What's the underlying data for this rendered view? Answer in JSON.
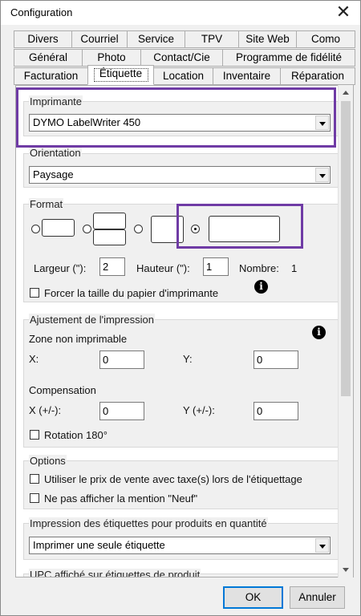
{
  "window": {
    "title": "Configuration"
  },
  "tabs": {
    "row1": [
      "Divers",
      "Courriel",
      "Service",
      "TPV",
      "Site Web",
      "Como"
    ],
    "row2": [
      "Général",
      "Photo",
      "Contact/Cie",
      "Programme de fidélité"
    ],
    "row3": [
      "Facturation",
      "Étiquette",
      "Location",
      "Inventaire",
      "Réparation"
    ],
    "active": "Étiquette"
  },
  "imprimante": {
    "label": "Imprimante",
    "selected": "DYMO LabelWriter 450"
  },
  "orientation": {
    "label": "Orientation",
    "selected": "Paysage"
  },
  "format": {
    "label": "Format",
    "selected_index": 3,
    "largeur_label": "Largeur (\"):",
    "largeur_value": "2",
    "hauteur_label": "Hauteur (\"):",
    "hauteur_value": "1",
    "nombre_label": "Nombre:",
    "nombre_value": "1",
    "force_paper_label": "Forcer la taille du papier d'imprimante"
  },
  "ajustement": {
    "label": "Ajustement de l'impression",
    "zone_label": "Zone non imprimable",
    "x_label": "X:",
    "x_value": "0",
    "y_label": "Y:",
    "y_value": "0",
    "compensation_label": "Compensation",
    "cx_label": "X (+/-):",
    "cx_value": "0",
    "cy_label": "Y (+/-):",
    "cy_value": "0",
    "rotation_label": "Rotation 180°"
  },
  "options": {
    "label": "Options",
    "opt1": "Utiliser le prix de vente avec taxe(s) lors de l'étiquettage",
    "opt2": "Ne pas afficher la mention \"Neuf\""
  },
  "quantite": {
    "label": "Impression des étiquettes pour produits en quantité",
    "selected": "Imprimer une seule étiquette"
  },
  "upc": {
    "label": "UPC affiché sur étiquettes de produit"
  },
  "buttons": {
    "ok": "OK",
    "cancel": "Annuler"
  },
  "colors": {
    "highlight": "#6f3ba5",
    "default_button_border": "#0078d7"
  }
}
